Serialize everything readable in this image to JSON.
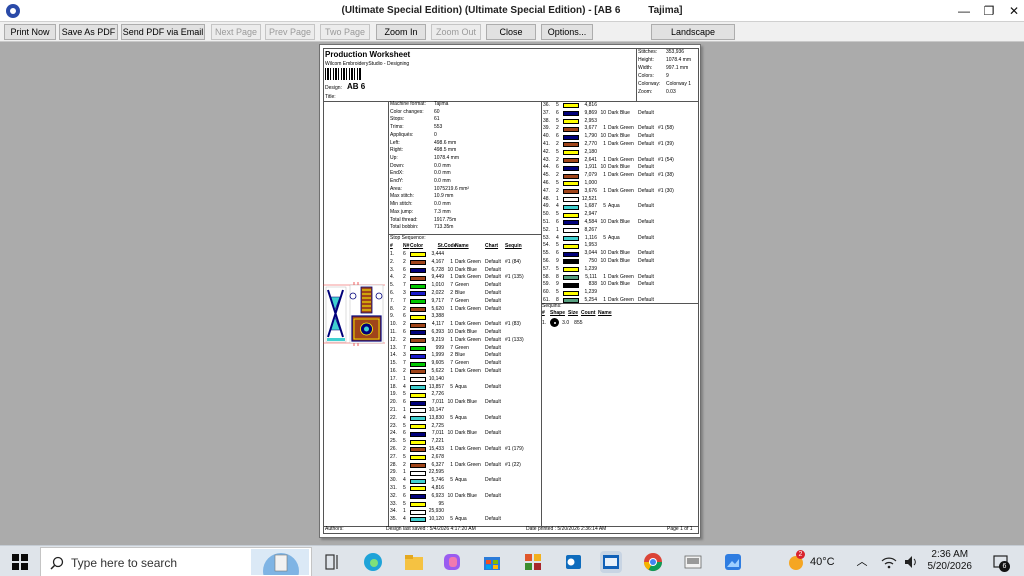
{
  "window": {
    "title": "(Ultimate Special Edition) (Ultimate Special Edition) - [AB 6          Tajima]",
    "minimize": "—",
    "restore": "❐",
    "close": "✕"
  },
  "toolbar": {
    "print_now": "Print Now",
    "save_pdf": "Save As PDF",
    "send_pdf": "Send PDF via Email",
    "next_page": "Next Page",
    "prev_page": "Prev Page",
    "two_page": "Two Page",
    "zoom_in": "Zoom In",
    "zoom_out": "Zoom Out",
    "close": "Close",
    "options": "Options...",
    "landscape": "Landscape"
  },
  "worksheet": {
    "title": "Production Worksheet",
    "company": "Wilcom EmbroideryStudio - Designing",
    "design_label": "Design:",
    "design_name": "AB 6",
    "title_label": "Title:",
    "stats": [
      {
        "k": "Stitches:",
        "v": "353,936"
      },
      {
        "k": "Height:",
        "v": "1078.4 mm"
      },
      {
        "k": "Width:",
        "v": "997.1 mm"
      },
      {
        "k": "Colors:",
        "v": "9"
      },
      {
        "k": "Colorway:",
        "v": "Colorway 1"
      },
      {
        "k": "Zoom:",
        "v": "0.03"
      }
    ],
    "info": [
      {
        "k": "Machine format:",
        "v": "Tajima"
      },
      {
        "k": "Color changes:",
        "v": "60"
      },
      {
        "k": "Stops:",
        "v": "61"
      },
      {
        "k": "Trims:",
        "v": "553"
      },
      {
        "k": "Appliqués:",
        "v": "0"
      },
      {
        "k": "Left:",
        "v": "498.6 mm"
      },
      {
        "k": "Right:",
        "v": "498.5 mm"
      },
      {
        "k": "Up:",
        "v": "1078.4 mm"
      },
      {
        "k": "Down:",
        "v": "0.0 mm"
      },
      {
        "k": "EndX:",
        "v": "0.0 mm"
      },
      {
        "k": "EndY:",
        "v": "0.0 mm"
      },
      {
        "k": "Area:",
        "v": "1075219.6 mm²"
      },
      {
        "k": "Max stitch:",
        "v": "10.9 mm"
      },
      {
        "k": "Min stitch:",
        "v": "0.0 mm"
      },
      {
        "k": "Max jump:",
        "v": "7.3 mm"
      },
      {
        "k": "Total thread:",
        "v": "1917.75m"
      },
      {
        "k": "Total bobbin:",
        "v": "713.35m"
      }
    ],
    "stop_sequence_label": "Stop Sequence:",
    "headers": {
      "num": "#",
      "n": "N#",
      "color": "Color",
      "st": "St.",
      "code": "Code",
      "name": "Name",
      "chart": "Chart",
      "sequin": "Sequin"
    },
    "stops_left": [
      {
        "num": "1.",
        "n": "6",
        "color": "#ffff00",
        "st": "3,444",
        "code": "",
        "name": "",
        "chart": "",
        "seq": ""
      },
      {
        "num": "2.",
        "n": "2",
        "color": "#a0451a",
        "st": "4,167",
        "code": "1",
        "name": "Dark Green",
        "chart": "Default",
        "seq": "#1 (84)"
      },
      {
        "num": "3.",
        "n": "6",
        "color": "#00007a",
        "st": "6,728",
        "code": "10",
        "name": "Dark Blue",
        "chart": "Default",
        "seq": ""
      },
      {
        "num": "4.",
        "n": "2",
        "color": "#a0451a",
        "st": "9,449",
        "code": "1",
        "name": "Dark Green",
        "chart": "Default",
        "seq": "#1 (135)"
      },
      {
        "num": "5.",
        "n": "7",
        "color": "#00c800",
        "st": "1,010",
        "code": "7",
        "name": "Green",
        "chart": "Default",
        "seq": ""
      },
      {
        "num": "6.",
        "n": "3",
        "color": "#1a1acc",
        "st": "2,022",
        "code": "2",
        "name": "Blue",
        "chart": "Default",
        "seq": ""
      },
      {
        "num": "7.",
        "n": "7",
        "color": "#00c800",
        "st": "9,717",
        "code": "7",
        "name": "Green",
        "chart": "Default",
        "seq": ""
      },
      {
        "num": "8.",
        "n": "2",
        "color": "#a0451a",
        "st": "5,620",
        "code": "1",
        "name": "Dark Green",
        "chart": "Default",
        "seq": ""
      },
      {
        "num": "9.",
        "n": "6",
        "color": "#ffff00",
        "st": "3,388",
        "code": "",
        "name": "",
        "chart": "",
        "seq": ""
      },
      {
        "num": "10.",
        "n": "2",
        "color": "#a0451a",
        "st": "4,117",
        "code": "1",
        "name": "Dark Green",
        "chart": "Default",
        "seq": "#1 (83)"
      },
      {
        "num": "11.",
        "n": "6",
        "color": "#00007a",
        "st": "6,393",
        "code": "10",
        "name": "Dark Blue",
        "chart": "Default",
        "seq": ""
      },
      {
        "num": "12.",
        "n": "2",
        "color": "#a0451a",
        "st": "9,219",
        "code": "1",
        "name": "Dark Green",
        "chart": "Default",
        "seq": "#1 (133)"
      },
      {
        "num": "13.",
        "n": "7",
        "color": "#00c800",
        "st": "999",
        "code": "7",
        "name": "Green",
        "chart": "Default",
        "seq": ""
      },
      {
        "num": "14.",
        "n": "3",
        "color": "#1a1acc",
        "st": "1,999",
        "code": "2",
        "name": "Blue",
        "chart": "Default",
        "seq": ""
      },
      {
        "num": "15.",
        "n": "7",
        "color": "#00c800",
        "st": "9,605",
        "code": "7",
        "name": "Green",
        "chart": "Default",
        "seq": ""
      },
      {
        "num": "16.",
        "n": "2",
        "color": "#a0451a",
        "st": "5,622",
        "code": "1",
        "name": "Dark Green",
        "chart": "Default",
        "seq": ""
      },
      {
        "num": "17.",
        "n": "1",
        "color": "#ffffff",
        "st": "10,140",
        "code": "",
        "name": "",
        "chart": "",
        "seq": ""
      },
      {
        "num": "18.",
        "n": "4",
        "color": "#40d0d0",
        "st": "13,857",
        "code": "5",
        "name": "Aqua",
        "chart": "Default",
        "seq": ""
      },
      {
        "num": "19.",
        "n": "5",
        "color": "#ffff00",
        "st": "2,726",
        "code": "",
        "name": "",
        "chart": "",
        "seq": ""
      },
      {
        "num": "20.",
        "n": "6",
        "color": "#00007a",
        "st": "7,011",
        "code": "10",
        "name": "Dark Blue",
        "chart": "Default",
        "seq": ""
      },
      {
        "num": "21.",
        "n": "1",
        "color": "#ffffff",
        "st": "10,147",
        "code": "",
        "name": "",
        "chart": "",
        "seq": ""
      },
      {
        "num": "22.",
        "n": "4",
        "color": "#40d0d0",
        "st": "13,830",
        "code": "5",
        "name": "Aqua",
        "chart": "Default",
        "seq": ""
      },
      {
        "num": "23.",
        "n": "5",
        "color": "#ffff00",
        "st": "2,725",
        "code": "",
        "name": "",
        "chart": "",
        "seq": ""
      },
      {
        "num": "24.",
        "n": "6",
        "color": "#00007a",
        "st": "7,011",
        "code": "10",
        "name": "Dark Blue",
        "chart": "Default",
        "seq": ""
      },
      {
        "num": "25.",
        "n": "5",
        "color": "#ffff00",
        "st": "7,221",
        "code": "",
        "name": "",
        "chart": "",
        "seq": ""
      },
      {
        "num": "26.",
        "n": "2",
        "color": "#a0451a",
        "st": "15,433",
        "code": "1",
        "name": "Dark Green",
        "chart": "Default",
        "seq": "#1 (179)"
      },
      {
        "num": "27.",
        "n": "5",
        "color": "#ffff00",
        "st": "2,678",
        "code": "",
        "name": "",
        "chart": "",
        "seq": ""
      },
      {
        "num": "28.",
        "n": "2",
        "color": "#a0451a",
        "st": "6,327",
        "code": "1",
        "name": "Dark Green",
        "chart": "Default",
        "seq": "#1 (22)"
      },
      {
        "num": "29.",
        "n": "1",
        "color": "#ffffff",
        "st": "22,595",
        "code": "",
        "name": "",
        "chart": "",
        "seq": ""
      },
      {
        "num": "30.",
        "n": "4",
        "color": "#40d0d0",
        "st": "5,746",
        "code": "5",
        "name": "Aqua",
        "chart": "Default",
        "seq": ""
      },
      {
        "num": "31.",
        "n": "5",
        "color": "#ffff00",
        "st": "4,816",
        "code": "",
        "name": "",
        "chart": "",
        "seq": ""
      },
      {
        "num": "32.",
        "n": "6",
        "color": "#00007a",
        "st": "6,923",
        "code": "10",
        "name": "Dark Blue",
        "chart": "Default",
        "seq": ""
      },
      {
        "num": "33.",
        "n": "5",
        "color": "#ffff00",
        "st": "95",
        "code": "",
        "name": "",
        "chart": "",
        "seq": ""
      },
      {
        "num": "34.",
        "n": "1",
        "color": "#ffffff",
        "st": "25,930",
        "code": "",
        "name": "",
        "chart": "",
        "seq": ""
      },
      {
        "num": "35.",
        "n": "4",
        "color": "#40d0d0",
        "st": "10,120",
        "code": "5",
        "name": "Aqua",
        "chart": "Default",
        "seq": ""
      }
    ],
    "stops_right": [
      {
        "num": "36.",
        "n": "5",
        "color": "#ffff00",
        "st": "4,816",
        "code": "",
        "name": "",
        "chart": "",
        "seq": ""
      },
      {
        "num": "37.",
        "n": "6",
        "color": "#00007a",
        "st": "9,869",
        "code": "10",
        "name": "Dark Blue",
        "chart": "Default",
        "seq": ""
      },
      {
        "num": "38.",
        "n": "5",
        "color": "#ffff00",
        "st": "2,953",
        "code": "",
        "name": "",
        "chart": "",
        "seq": ""
      },
      {
        "num": "39.",
        "n": "2",
        "color": "#a0451a",
        "st": "3,677",
        "code": "1",
        "name": "Dark Green",
        "chart": "Default",
        "seq": "#1 (58)"
      },
      {
        "num": "40.",
        "n": "6",
        "color": "#00007a",
        "st": "1,790",
        "code": "10",
        "name": "Dark Blue",
        "chart": "Default",
        "seq": ""
      },
      {
        "num": "41.",
        "n": "2",
        "color": "#a0451a",
        "st": "2,770",
        "code": "1",
        "name": "Dark Green",
        "chart": "Default",
        "seq": "#1 (39)"
      },
      {
        "num": "42.",
        "n": "5",
        "color": "#ffff00",
        "st": "2,180",
        "code": "",
        "name": "",
        "chart": "",
        "seq": ""
      },
      {
        "num": "43.",
        "n": "2",
        "color": "#a0451a",
        "st": "2,641",
        "code": "1",
        "name": "Dark Green",
        "chart": "Default",
        "seq": "#1 (54)"
      },
      {
        "num": "44.",
        "n": "6",
        "color": "#00007a",
        "st": "1,911",
        "code": "10",
        "name": "Dark Blue",
        "chart": "Default",
        "seq": ""
      },
      {
        "num": "45.",
        "n": "2",
        "color": "#a0451a",
        "st": "7,079",
        "code": "1",
        "name": "Dark Green",
        "chart": "Default",
        "seq": "#1 (38)"
      },
      {
        "num": "46.",
        "n": "5",
        "color": "#ffff00",
        "st": "1,000",
        "code": "",
        "name": "",
        "chart": "",
        "seq": ""
      },
      {
        "num": "47.",
        "n": "2",
        "color": "#a0451a",
        "st": "3,676",
        "code": "1",
        "name": "Dark Green",
        "chart": "Default",
        "seq": "#1 (30)"
      },
      {
        "num": "48.",
        "n": "1",
        "color": "#ffffff",
        "st": "12,521",
        "code": "",
        "name": "",
        "chart": "",
        "seq": ""
      },
      {
        "num": "49.",
        "n": "4",
        "color": "#40d0d0",
        "st": "1,687",
        "code": "5",
        "name": "Aqua",
        "chart": "Default",
        "seq": ""
      },
      {
        "num": "50.",
        "n": "5",
        "color": "#ffff00",
        "st": "2,947",
        "code": "",
        "name": "",
        "chart": "",
        "seq": ""
      },
      {
        "num": "51.",
        "n": "6",
        "color": "#00007a",
        "st": "4,584",
        "code": "10",
        "name": "Dark Blue",
        "chart": "Default",
        "seq": ""
      },
      {
        "num": "52.",
        "n": "1",
        "color": "#ffffff",
        "st": "8,267",
        "code": "",
        "name": "",
        "chart": "",
        "seq": ""
      },
      {
        "num": "53.",
        "n": "4",
        "color": "#40d0d0",
        "st": "1,116",
        "code": "5",
        "name": "Aqua",
        "chart": "Default",
        "seq": ""
      },
      {
        "num": "54.",
        "n": "5",
        "color": "#ffff00",
        "st": "1,953",
        "code": "",
        "name": "",
        "chart": "",
        "seq": ""
      },
      {
        "num": "55.",
        "n": "6",
        "color": "#00007a",
        "st": "3,044",
        "code": "10",
        "name": "Dark Blue",
        "chart": "Default",
        "seq": ""
      },
      {
        "num": "56.",
        "n": "9",
        "color": "#000000",
        "st": "750",
        "code": "10",
        "name": "Dark Blue",
        "chart": "Default",
        "seq": ""
      },
      {
        "num": "57.",
        "n": "5",
        "color": "#ffff00",
        "st": "1,239",
        "code": "",
        "name": "",
        "chart": "",
        "seq": ""
      },
      {
        "num": "58.",
        "n": "8",
        "color": "#58a080",
        "st": "5,111",
        "code": "1",
        "name": "Dark Green",
        "chart": "Default",
        "seq": ""
      },
      {
        "num": "59.",
        "n": "9",
        "color": "#000000",
        "st": "838",
        "code": "10",
        "name": "Dark Blue",
        "chart": "Default",
        "seq": ""
      },
      {
        "num": "60.",
        "n": "5",
        "color": "#ffff00",
        "st": "1,239",
        "code": "",
        "name": "",
        "chart": "",
        "seq": ""
      },
      {
        "num": "61.",
        "n": "8",
        "color": "#58a080",
        "st": "5,254",
        "code": "1",
        "name": "Dark Green",
        "chart": "Default",
        "seq": ""
      }
    ],
    "sequins_label": "Sequins:",
    "sequin_headers": {
      "num": "#",
      "shape": "Shape",
      "size": "Size",
      "count": "Count",
      "name": "Name"
    },
    "sequin_row": {
      "num": "1.",
      "size": "3.0",
      "count": "855"
    },
    "footer": {
      "authors": "Authors:",
      "saved": "Design last saved : 5/4/2026 4:17:20 AM",
      "printed": "Date printed : 5/20/2026 2:36:14 AM",
      "page": "Page 1 of 1"
    }
  },
  "taskbar": {
    "search_placeholder": "Type here to search",
    "weather_badge": "2",
    "temperature": "40°C",
    "time": "2:36 AM",
    "date": "5/20/2026",
    "notification_count": "6",
    "colors": {
      "bg": "#dfe4ea",
      "accent": "#0078d4"
    }
  }
}
